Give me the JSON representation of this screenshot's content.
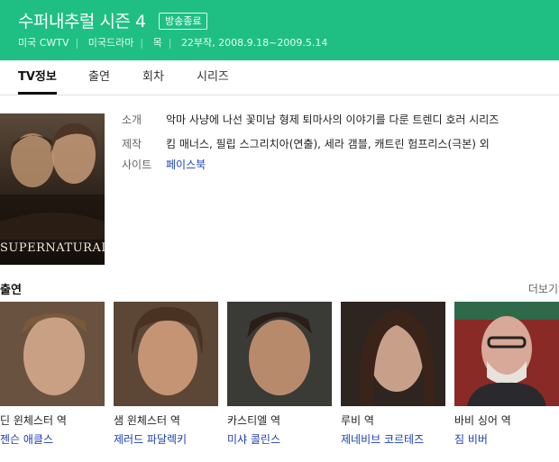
{
  "header": {
    "title": "수퍼내추럴 시즌 4",
    "badge": "방송종료",
    "meta": [
      "미국 CWTV",
      "미국드라마",
      "목",
      "22부작, 2008.9.18~2009.5.14"
    ]
  },
  "tabs": [
    "TV정보",
    "출연",
    "회차",
    "시리즈"
  ],
  "poster": {
    "text": "SUPERNATURAL"
  },
  "info": [
    {
      "label": "소개",
      "value": "악마 사냥에 나선 꽃미남 형제 퇴마사의 이야기를 다룬 트렌디 호러 시리즈",
      "link": false
    },
    {
      "label": "제작",
      "value": "킴 매너스, 필립 스그리치아(연출), 세라 갬블, 캐트린 험프리스(극본) 외",
      "link": false
    },
    {
      "label": "사이트",
      "value": "페이스북",
      "link": true
    }
  ],
  "cast_section": {
    "title": "출연",
    "more": "더보기"
  },
  "cast": [
    {
      "role": "딘 윈체스터 역",
      "actor": "젠슨 애클스"
    },
    {
      "role": "샘 윈체스터 역",
      "actor": "제러드 파달렉키"
    },
    {
      "role": "카스티엘 역",
      "actor": "미샤 콜린스"
    },
    {
      "role": "루비 역",
      "actor": "제네비브 코르테즈"
    },
    {
      "role": "바비 싱어 역",
      "actor": "짐 비버"
    }
  ],
  "colors": {
    "header_bg": "#1fbf83",
    "link": "#1a3fb3"
  }
}
